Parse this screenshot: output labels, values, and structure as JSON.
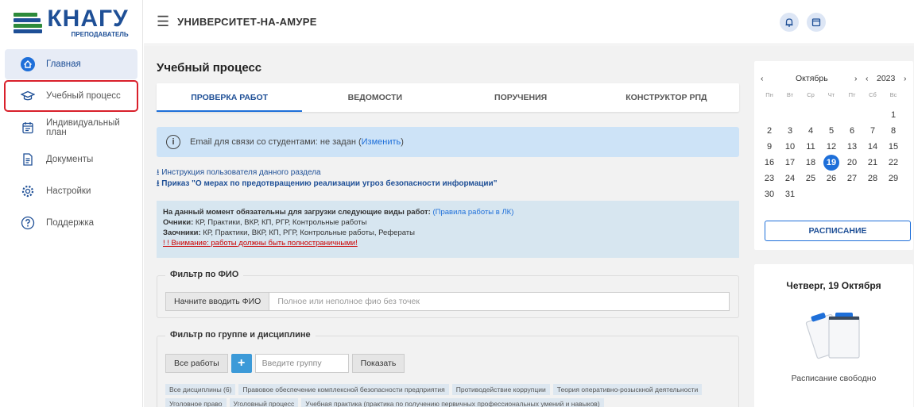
{
  "logo": {
    "main": "КНАГУ",
    "sub": "ПРЕПОДАВАТЕЛЬ"
  },
  "header": {
    "org_name": "УНИВЕРСИТЕТ-НА-АМУРЕ"
  },
  "sidebar": {
    "items": [
      {
        "label": "Главная",
        "icon": "home-icon"
      },
      {
        "label": "Учебный процесс",
        "icon": "graduation-cap-icon"
      },
      {
        "label": "Индивидуальный план",
        "icon": "calendar-plan-icon"
      },
      {
        "label": "Документы",
        "icon": "document-icon"
      },
      {
        "label": "Настройки",
        "icon": "gear-icon"
      },
      {
        "label": "Поддержка",
        "icon": "help-icon"
      }
    ]
  },
  "main": {
    "title": "Учебный процесс",
    "tabs": [
      {
        "label": "ПРОВЕРКА РАБОТ"
      },
      {
        "label": "ВЕДОМОСТИ"
      },
      {
        "label": "ПОРУЧЕНИЯ"
      },
      {
        "label": "КОНСТРУКТОР РПД"
      }
    ],
    "info": {
      "text": "Email для связи со студентами: не задан (",
      "link": "Изменить",
      "close": ")"
    },
    "doc_links": {
      "link1": "Инструкция пользователя данного раздела",
      "link2": "Приказ \"О мерах по предотвращению реализации угроз безопасности информации\""
    },
    "rules": {
      "line1_bold": "На данный момент обязательны для загрузки следующие виды работ:",
      "line1_link": "(Правила работы в ЛК)",
      "line2_bold": "Очники:",
      "line2_text": " КР, Практики, ВКР, КП, РГР, Контрольные работы",
      "line3_bold": "Заочники:",
      "line3_text": " КР, Практики, ВКР, КП, РГР, Контрольные работы, Рефераты",
      "warning": "! ! Внимание: работы должны быть полностраничными!"
    },
    "fio_filter": {
      "legend": "Фильтр по ФИО",
      "label": "Начните вводить ФИО",
      "placeholder": "Полное или неполное фио без точек"
    },
    "group_filter": {
      "legend": "Фильтр по группе и дисциплине",
      "all_works": "Все работы",
      "add": "+",
      "group_placeholder": "Введите группу",
      "show": "Показать",
      "disciplines": [
        "Все дисциплины (6)",
        "Правовое обеспечение комплексной безопасности предприятия",
        "Противодействие коррупции",
        "Теория оперативно-розыскной деятельности",
        "Уголовное право",
        "Уголовный процесс",
        "Учебная практика (практика по получению первичных профессиональных умений и навыков)"
      ]
    }
  },
  "calendar": {
    "prev": "‹",
    "month": "Октябрь",
    "next": "›",
    "year_prev": "‹",
    "year": "2023",
    "year_next": "›",
    "dow": [
      "Пн",
      "Вт",
      "Ср",
      "Чт",
      "Пт",
      "Сб",
      "Вс"
    ],
    "leading_blanks": 6,
    "days": [
      "1",
      "2",
      "3",
      "4",
      "5",
      "6",
      "7",
      "8",
      "9",
      "10",
      "11",
      "12",
      "13",
      "14",
      "15",
      "16",
      "17",
      "18",
      "19",
      "20",
      "21",
      "22",
      "23",
      "24",
      "25",
      "26",
      "27",
      "28",
      "29",
      "30",
      "31"
    ],
    "today": "19",
    "schedule_button": "РАСПИСАНИЕ"
  },
  "day_card": {
    "title": "Четверг, 19 Октября",
    "status": "Расписание свободно"
  },
  "colors": {
    "brand": "#1e4f96",
    "accent": "#1e6fd9",
    "highlight_border": "#d9202b",
    "info_bg": "#cde3f7"
  }
}
